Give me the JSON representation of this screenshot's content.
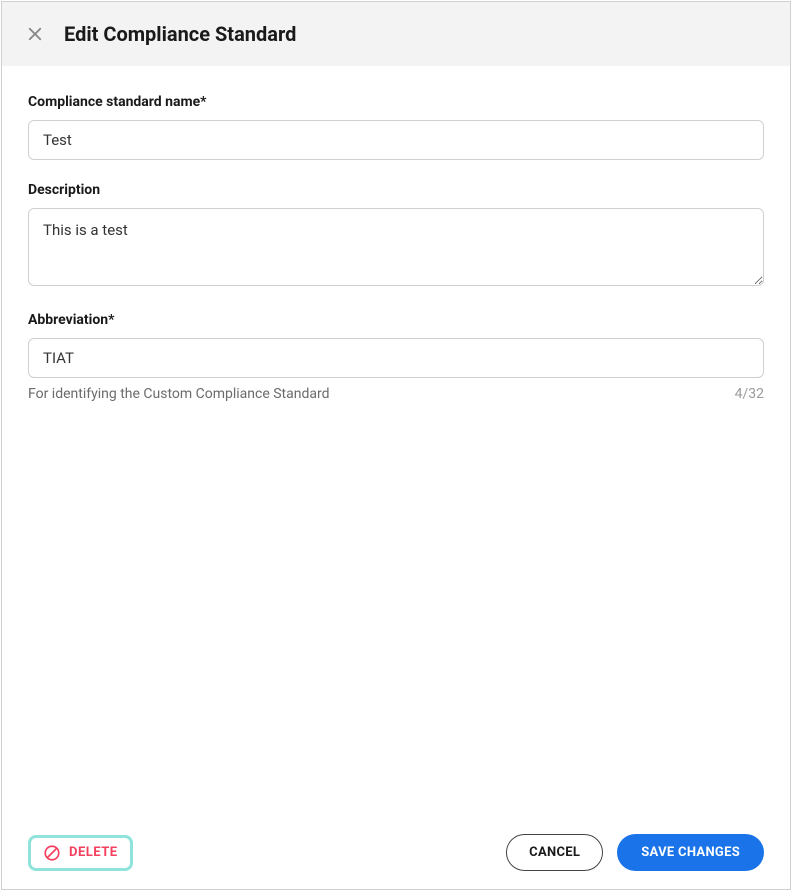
{
  "header": {
    "title": "Edit Compliance Standard"
  },
  "form": {
    "name": {
      "label": "Compliance standard name*",
      "value": "Test"
    },
    "description": {
      "label": "Description",
      "value": "This is a test"
    },
    "abbreviation": {
      "label": "Abbreviation*",
      "value": "TIAT",
      "helper": "For identifying the Custom Compliance Standard",
      "counter": "4/32"
    }
  },
  "footer": {
    "delete_label": "DELETE",
    "cancel_label": "CANCEL",
    "save_label": "SAVE CHANGES"
  }
}
